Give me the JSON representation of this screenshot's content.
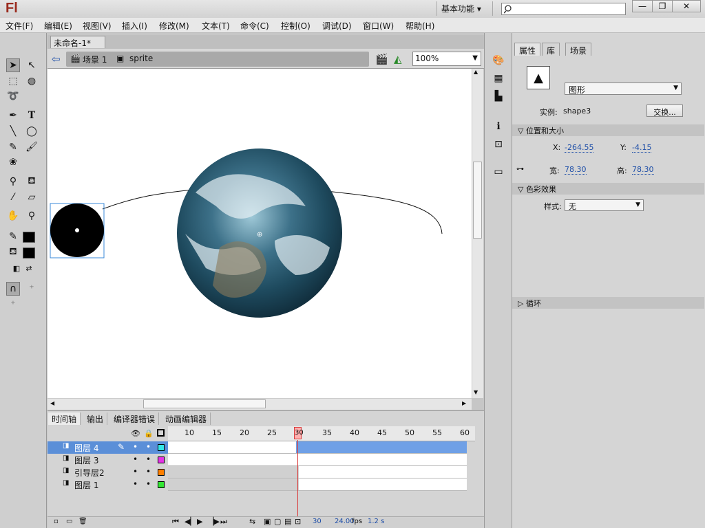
{
  "app": {
    "logo": "Fl",
    "workspace": "基本功能",
    "workspace_caret": "▾"
  },
  "window": {
    "min": "—",
    "restore": "❐",
    "close": "✕"
  },
  "menu": [
    "文件(F)",
    "编辑(E)",
    "视图(V)",
    "插入(I)",
    "修改(M)",
    "文本(T)",
    "命令(C)",
    "控制(O)",
    "调试(D)",
    "窗口(W)",
    "帮助(H)"
  ],
  "document": {
    "tab_title": "未命名-1*",
    "tab_close": "×",
    "breadcrumb": {
      "scene": "场景 1",
      "symbol": "sprite"
    },
    "zoom": "100%"
  },
  "timeline": {
    "tabs": [
      "时间轴",
      "输出",
      "编译器错误",
      "动画编辑器"
    ],
    "ruler": [
      "10",
      "15",
      "20",
      "25",
      "30",
      "35",
      "40",
      "45",
      "50",
      "55",
      "60"
    ],
    "current_frame_marker": "30",
    "layers": [
      {
        "name": "图层 4",
        "color": "#33e6e6",
        "selected": true
      },
      {
        "name": "图层 3",
        "color": "#e633e6",
        "selected": false
      },
      {
        "name": "引导层2",
        "color": "#ff7f00",
        "selected": false
      },
      {
        "name": "图层 1",
        "color": "#33e633",
        "selected": false
      }
    ],
    "status": {
      "frame": "30",
      "fps": "24.00",
      "fps_unit": "fps",
      "time": "1.2 s"
    }
  },
  "properties": {
    "tabs": [
      "属性",
      "库",
      "场景"
    ],
    "type": "图形",
    "instance_label": "实例:",
    "instance_name": "shape3",
    "swap_button": "交换...",
    "position_section": "位置和大小",
    "x_label": "X:",
    "x": "-264.55",
    "y_label": "Y:",
    "y": "-4.15",
    "w_label": "宽:",
    "w": "78.30",
    "h_label": "高:",
    "h": "78.30",
    "color_section": "色彩效果",
    "style_label": "样式:",
    "style_value": "无",
    "loop_section": "循环"
  },
  "colors": {
    "accent": "#5b8fd8",
    "playhead": "#d83a3a",
    "link": "#1f4fa8"
  }
}
